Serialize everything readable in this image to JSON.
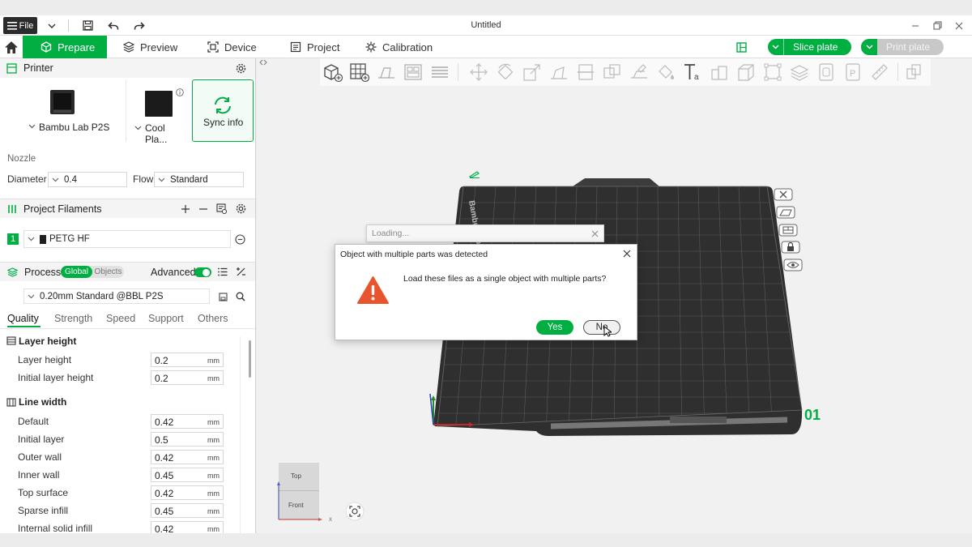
{
  "window": {
    "title": "Untitled",
    "file_label": "File"
  },
  "tabs": [
    {
      "label": "Prepare",
      "icon": "cube-icon"
    },
    {
      "label": "Preview",
      "icon": "layers-icon"
    },
    {
      "label": "Device",
      "icon": "device-icon"
    },
    {
      "label": "Project",
      "icon": "project-icon"
    },
    {
      "label": "Calibration",
      "icon": "calibration-icon"
    }
  ],
  "actions": {
    "slice_label": "Slice plate",
    "print_label": "Print plate",
    "accent": "#00ae42"
  },
  "printer": {
    "section_title": "Printer",
    "printer_name": "Bambu Lab P2S",
    "plate_name": "Cool Pla...",
    "sync_label": "Sync info",
    "nozzle_label": "Nozzle",
    "diameter_label": "Diameter",
    "diameter_value": "0.4",
    "flow_label": "Flow",
    "flow_value": "Standard"
  },
  "filaments": {
    "section_title": "Project Filaments",
    "items": [
      {
        "index": "1",
        "name": "PETG HF",
        "color": "#1f1f1f"
      }
    ]
  },
  "process": {
    "section_title": "Process",
    "toggle_global": "Global",
    "toggle_objects": "Objects",
    "advanced_label": "Advanced",
    "preset": "0.20mm Standard @BBL P2S",
    "tabs": [
      "Quality",
      "Strength",
      "Speed",
      "Support",
      "Others"
    ],
    "groups": [
      {
        "title": "Layer height",
        "rows": [
          {
            "label": "Layer height",
            "value": "0.2",
            "unit": "mm"
          },
          {
            "label": "Initial layer height",
            "value": "0.2",
            "unit": "mm"
          }
        ]
      },
      {
        "title": "Line width",
        "rows": [
          {
            "label": "Default",
            "value": "0.42",
            "unit": "mm"
          },
          {
            "label": "Initial layer",
            "value": "0.5",
            "unit": "mm"
          },
          {
            "label": "Outer wall",
            "value": "0.42",
            "unit": "mm"
          },
          {
            "label": "Inner wall",
            "value": "0.45",
            "unit": "mm"
          },
          {
            "label": "Top surface",
            "value": "0.42",
            "unit": "mm"
          },
          {
            "label": "Sparse infill",
            "value": "0.45",
            "unit": "mm"
          },
          {
            "label": "Internal solid infill",
            "value": "0.42",
            "unit": "mm"
          }
        ]
      }
    ]
  },
  "viewport": {
    "plate_number": "01",
    "cube_top": "Top",
    "cube_front": "Front",
    "axis_x": "x",
    "bed_brand": "Bambu Lab"
  },
  "loading_dialog": {
    "title": "Loading..."
  },
  "dialog": {
    "title": "Object with multiple parts was detected",
    "message": "Load these files as a single object with multiple parts?",
    "yes_label": "Yes",
    "no_label": "No",
    "warning_color": "#e8542e"
  }
}
